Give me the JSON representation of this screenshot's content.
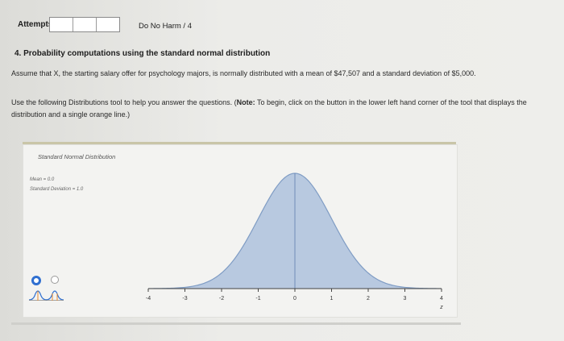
{
  "header": {
    "attempts_label": "Attempts",
    "attempt_boxes": [
      "",
      "",
      ""
    ],
    "grade_prefix": "Do No Harm",
    "grade_suffix": " / 4"
  },
  "question": {
    "title": "4. Probability computations using the standard normal distribution",
    "assume_text": "Assume that X, the starting salary offer for psychology majors, is normally distributed with a mean of $47,507 and a standard deviation of $5,000.",
    "instructions_lead": "Use the following Distributions tool to help you answer the questions. (",
    "instructions_note_label": "Note:",
    "instructions_rest": " To begin, click on the button in the lower left hand corner of the tool that displays the distribution and a single orange line.)"
  },
  "tool": {
    "title": "Standard Normal Distribution",
    "mean_text": "Mean = 0.0",
    "sd_text": "Standard Deviation = 1.0",
    "radio_selected": 0,
    "colors": {
      "curve_fill": "#b8c9e0",
      "curve_stroke": "#7f9cc4",
      "radio_accent": "#2f6fd0"
    },
    "buttons": [
      "curve-single-line-icon",
      "curve-two-lines-icon"
    ]
  },
  "chart_data": {
    "type": "area",
    "title": "Standard Normal Distribution",
    "distribution": "normal",
    "mean": 0.0,
    "sd": 1.0,
    "xlim": [
      -4,
      4
    ],
    "x_ticks": [
      -4,
      -3,
      -2,
      -1,
      0,
      1,
      2,
      3,
      4
    ],
    "tick_labels": [
      "-4",
      "-3",
      "-2",
      "-1",
      "0",
      "1",
      "2",
      "3",
      "4"
    ],
    "xlabel": "z",
    "center_line_x": 0
  }
}
